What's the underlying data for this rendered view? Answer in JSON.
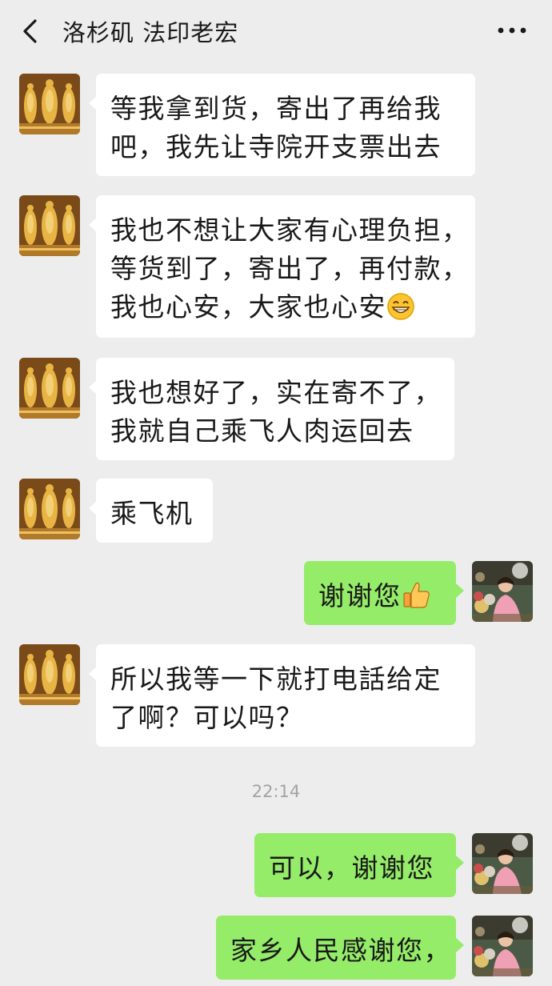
{
  "header": {
    "title": "洛杉矶 法印老宏",
    "back_icon": "chevron-left-icon",
    "more_icon": "more-dots-icon"
  },
  "messages": [
    {
      "side": "in",
      "lines": [
        "等我拿到货，寄出了再给我",
        "吧，我先让寺院开支票出去"
      ]
    },
    {
      "side": "in",
      "lines": [
        "我也不想让大家有心理负担，",
        "等货到了，寄出了，再付款，",
        "我也心安，大家也心安"
      ],
      "emoji": "grinning-face-icon"
    },
    {
      "side": "in",
      "lines": [
        "我也想好了，实在寄不了，",
        "我就自己乘飞人肉运回去"
      ]
    },
    {
      "side": "in",
      "lines": [
        "乘飞机"
      ]
    },
    {
      "side": "out",
      "lines": [
        "谢谢您"
      ],
      "emoji": "thumbs-up-icon"
    },
    {
      "side": "in",
      "lines": [
        "所以我等一下就打电話给定",
        "了啊？可以吗？"
      ]
    },
    {
      "side": "out",
      "lines": [
        "可以，谢谢您"
      ]
    },
    {
      "side": "out",
      "lines": [
        "家乡人民感谢您，"
      ]
    }
  ],
  "timestamp": "22:14",
  "colors": {
    "background": "#ededed",
    "incoming_bubble": "#ffffff",
    "outgoing_bubble": "#95ec69",
    "text": "#191919",
    "timestamp": "#a3a3a3"
  }
}
